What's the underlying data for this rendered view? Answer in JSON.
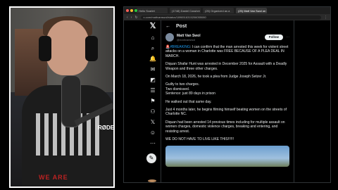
{
  "browser": {
    "tabs": [
      {
        "label": "Hello Scarlet",
        "active": false
      },
      {
        "label": "(1748) Daniel Cossher Commentary",
        "active": false
      },
      {
        "label": "(25) Organized as a",
        "active": false
      },
      {
        "label": "(25) Matt Van Swol on X",
        "active": true
      }
    ],
    "url": "x.com/mattvanswol/status/1896516315206055080"
  },
  "nav": {
    "icons": [
      "x-logo-icon",
      "home-icon",
      "search-icon",
      "notifications-icon",
      "messages-icon",
      "grok-icon",
      "lists-icon",
      "bookmarks-icon",
      "communities-icon",
      "premium-icon",
      "profile-icon",
      "more-icon"
    ]
  },
  "post": {
    "header": "Post",
    "author_name": "Matt Van Swol",
    "author_handle": "@mattvanswol",
    "follow_label": "Follow",
    "more_label": "···",
    "paragraphs": [
      {
        "tag": "#BREAKING",
        "text": ": I can confirm that the man arrested this week for violent street attacks on a woman in Charlotte was FREE BECAUSE OF A PLEA DEAL IN MARCH."
      },
      {
        "tag": "",
        "text": "Diquan Shafar Hunt was arrested in December 2025 for Assault with a Deadly Weapon and three other charges."
      },
      {
        "tag": "",
        "text": "On March 18, 2026, he took a plea from Judge Joseph Setzer Jr."
      },
      {
        "tag": "",
        "text": "Guilty to two charges.\nTwo dismissed.\nSentence: just 89 days in prison"
      },
      {
        "tag": "",
        "text": "He walked out that same day."
      },
      {
        "tag": "",
        "text": "Just 4 months later, he begins filming himself beating women on the streets of Charlotte NC."
      },
      {
        "tag": "",
        "text": "Diquan had been arrested 14 previous times including for multiple assault on women charges, domestic violence charges, breaking and entering, and resisting arrest."
      },
      {
        "tag": "",
        "text": "WE DO NOT HAVE TO LIVE LIKE THIS!!!!!!"
      }
    ]
  },
  "webcam": {
    "mic_brand": "RØDE",
    "shirt_text": "WE ARE"
  },
  "colors": {
    "accent": "#1d9bf0",
    "background": "#000000",
    "text": "#e7e9ea"
  }
}
